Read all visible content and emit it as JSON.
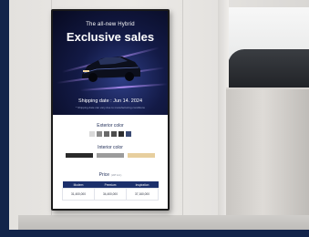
{
  "sign": {
    "tagline": "The all-new Hybrid",
    "headline": "Exclusive sales",
    "shipping": "Shipping date : Jun 14. 2024",
    "fine_print": "* Shipping date can vary due to manufacturing conditions",
    "exterior_title": "Exterior color",
    "exterior_colors": [
      "#d9d9d9",
      "#8a8a8a",
      "#6a6a6a",
      "#4c4c4c",
      "#2e2e2e",
      "#3a4a72"
    ],
    "interior_title": "Interior color",
    "interior_colors": [
      "#2a2a2a",
      "#9b9b9b",
      "#e7cf9e"
    ],
    "price_title": "Price",
    "price_note": "(VAT incl.)",
    "price_headers": [
      "Modern",
      "Premium",
      "Inspiration"
    ],
    "price_values": [
      "31,400,000",
      "34,400,000",
      "37,160,000"
    ]
  },
  "colors": {
    "accent": "#1b2f6b",
    "hero_dark": "#070a20",
    "frame": "#12244a"
  }
}
